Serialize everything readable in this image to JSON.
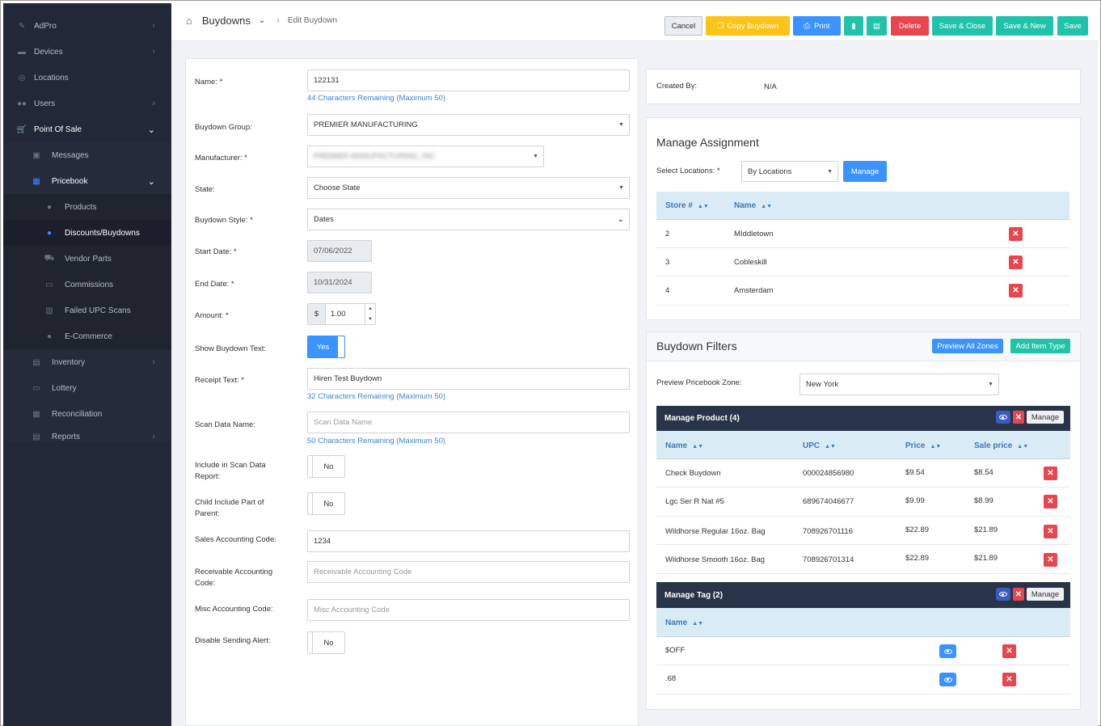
{
  "sidebar": {
    "items": [
      {
        "label": "AdPro",
        "icon": "pen-icon",
        "chevron": "›"
      },
      {
        "label": "Devices",
        "icon": "device-icon",
        "chevron": "›"
      },
      {
        "label": "Locations",
        "icon": "location-pin-icon",
        "chevron": ""
      },
      {
        "label": "Users",
        "icon": "users-icon",
        "chevron": "›"
      },
      {
        "label": "Point Of Sale",
        "icon": "cart-icon",
        "chevron": "⌄"
      },
      {
        "label": "Messages",
        "icon": "message-icon",
        "chevron": ""
      },
      {
        "label": "Pricebook",
        "icon": "calculator-icon",
        "chevron": "⌄"
      },
      {
        "label": "Products",
        "icon": "product-icon",
        "chevron": ""
      },
      {
        "label": "Discounts/Buydowns",
        "icon": "discount-icon",
        "chevron": ""
      },
      {
        "label": "Vendor Parts",
        "icon": "truck-icon",
        "chevron": ""
      },
      {
        "label": "Commissions",
        "icon": "commission-icon",
        "chevron": ""
      },
      {
        "label": "Failed UPC Scans",
        "icon": "barcode-icon",
        "chevron": ""
      },
      {
        "label": "E-Commerce",
        "icon": "ecommerce-icon",
        "chevron": ""
      },
      {
        "label": "Inventory",
        "icon": "inventory-icon",
        "chevron": "›"
      },
      {
        "label": "Lottery",
        "icon": "lottery-icon",
        "chevron": ""
      },
      {
        "label": "Reconciliation",
        "icon": "grid-icon",
        "chevron": ""
      },
      {
        "label": "Reports",
        "icon": "reports-icon",
        "chevron": "›"
      }
    ]
  },
  "header": {
    "title": "Buydowns",
    "subtitle": "Edit Buydown",
    "sep": "›",
    "chevron": "⌄",
    "tag_icon": "tag-icon"
  },
  "toolbar": {
    "cancel": "Cancel",
    "copy": "Copy Buydown",
    "print": "Print",
    "delete": "Delete",
    "save_close": "Save & Close",
    "save_new": "Save & New",
    "save": "Save"
  },
  "form": {
    "name_label": "Name: *",
    "name_value": "122131",
    "name_hint": "44 Characters Remaining (Maximum 50)",
    "group_label": "Buydown Group:",
    "group_value": "PREMIER MANUFACTURING",
    "manufacturer_label": "Manufacturer: *",
    "manufacturer_value": "PREMIER MANUFACTURING, INC",
    "state_label": "State:",
    "state_value": "Choose State",
    "style_label": "Buydown Style: *",
    "style_value": "Dates",
    "start_label": "Start Date: *",
    "start_value": "07/06/2022",
    "end_label": "End Date: *",
    "end_value": "10/31/2024",
    "amount_label": "Amount: *",
    "amount_prefix": "$",
    "amount_value": "1.00",
    "show_text_label": "Show Buydown Text:",
    "show_text_value": "Yes",
    "receipt_label": "Receipt Text: *",
    "receipt_value": "Hiren Test Buydown",
    "receipt_hint": "32 Characters Remaining (Maximum 50)",
    "scan_label": "Scan Data Name:",
    "scan_placeholder": "Scan Data Name",
    "scan_hint": "50 Characters Remaining (Maximum 50)",
    "include_label": "Include in Scan Data Report:",
    "include_value": "No",
    "child_label": "Child Include Part of Parent:",
    "child_value": "No",
    "sales_label": "Sales Accounting Code:",
    "sales_value": "1234",
    "recv_label": "Receivable Accounting Code:",
    "recv_placeholder": "Receivable Accounting Code",
    "misc_label": "Misc Accounting Code:",
    "misc_placeholder": "Misc Accounting Code",
    "disable_label": "Disable Sending Alert:",
    "disable_value": "No"
  },
  "created": {
    "label": "Created By:",
    "value": "N/A"
  },
  "assignment": {
    "title": "Manage Assignment",
    "select_label": "Select Locations: *",
    "select_value": "By Locations",
    "manage": "Manage",
    "col_store": "Store #",
    "col_name": "Name",
    "rows": [
      {
        "store": "2",
        "name": "MIddletown"
      },
      {
        "store": "3",
        "name": "Cobleskill"
      },
      {
        "store": "4",
        "name": "Amsterdam"
      }
    ]
  },
  "filters": {
    "title": "Buydown Filters",
    "preview_all": "Preview All Zones",
    "add_item": "Add Item Type",
    "zone_label": "Preview Pricebook Zone:",
    "zone_value": "New York"
  },
  "products": {
    "title": "Manage Product (4)",
    "manage": "Manage",
    "cols": [
      "Name",
      "UPC",
      "Price",
      "Sale price"
    ],
    "rows": [
      {
        "name": "Check Buydown",
        "upc": "000024856980",
        "price": "$9.54",
        "sale": "$8.54"
      },
      {
        "name": "Lgc Ser R Nat #5",
        "upc": "689674046677",
        "price": "$9.99",
        "sale": "$8.99"
      },
      {
        "name": "Wildhorse Regular 16oz. Bag",
        "upc": "708926701116",
        "price": "$22.89",
        "sale": "$21.89"
      },
      {
        "name": "Wildhorse Smooth 16oz. Bag",
        "upc": "708926701314",
        "price": "$22.89",
        "sale": "$21.89"
      }
    ]
  },
  "tags": {
    "title": "Manage Tag (2)",
    "manage": "Manage",
    "col_name": "Name",
    "rows": [
      {
        "name": "$OFF"
      },
      {
        "name": ".68"
      }
    ]
  },
  "colors": {
    "accent": "#3b93ff",
    "danger": "#e8464f",
    "teal": "#20c3aa",
    "yellow": "#fcc419",
    "sidebar": "#232838",
    "dark_head": "#283447"
  }
}
